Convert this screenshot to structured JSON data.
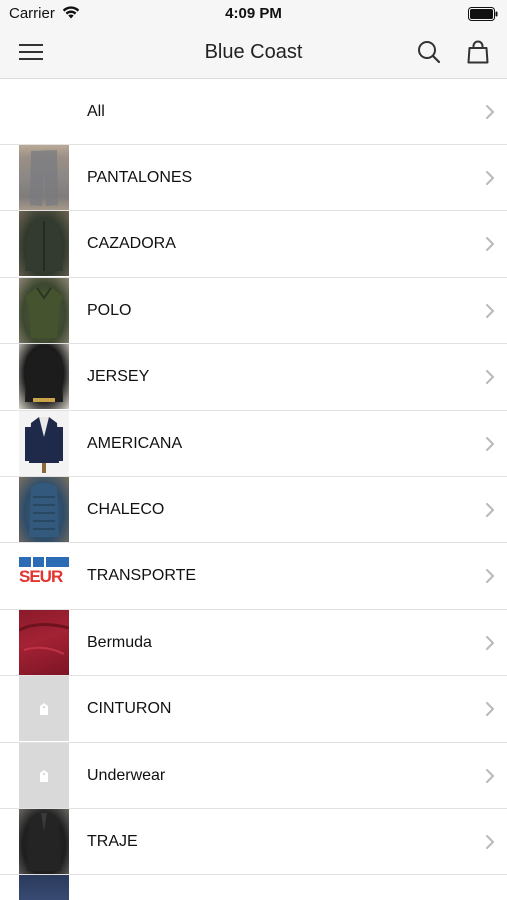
{
  "status_bar": {
    "carrier": "Carrier",
    "time": "4:09 PM"
  },
  "nav": {
    "title": "Blue Coast",
    "menu_icon": "hamburger-menu-icon",
    "search_icon": "search-icon",
    "bag_icon": "shopping-bag-icon"
  },
  "categories": [
    {
      "label": "All",
      "thumb": "none"
    },
    {
      "label": "PANTALONES",
      "thumb": "pantalones"
    },
    {
      "label": "CAZADORA",
      "thumb": "cazadora"
    },
    {
      "label": "POLO",
      "thumb": "polo"
    },
    {
      "label": "JERSEY",
      "thumb": "jersey"
    },
    {
      "label": "AMERICANA",
      "thumb": "americana"
    },
    {
      "label": "CHALECO",
      "thumb": "chaleco"
    },
    {
      "label": "TRANSPORTE",
      "thumb": "transporte"
    },
    {
      "label": "Bermuda",
      "thumb": "bermuda"
    },
    {
      "label": "CINTURON",
      "thumb": "placeholder"
    },
    {
      "label": "Underwear",
      "thumb": "placeholder"
    },
    {
      "label": "TRAJE",
      "thumb": "traje"
    },
    {
      "label": "",
      "thumb": "last"
    }
  ],
  "transporte_logo_text": "SEUR",
  "colors": {
    "bar_background": "#f6f6f6",
    "separator": "#e2e2e2",
    "chevron": "#c7c7cc",
    "seur_blue": "#2b6cb5",
    "seur_red": "#e3342f"
  }
}
